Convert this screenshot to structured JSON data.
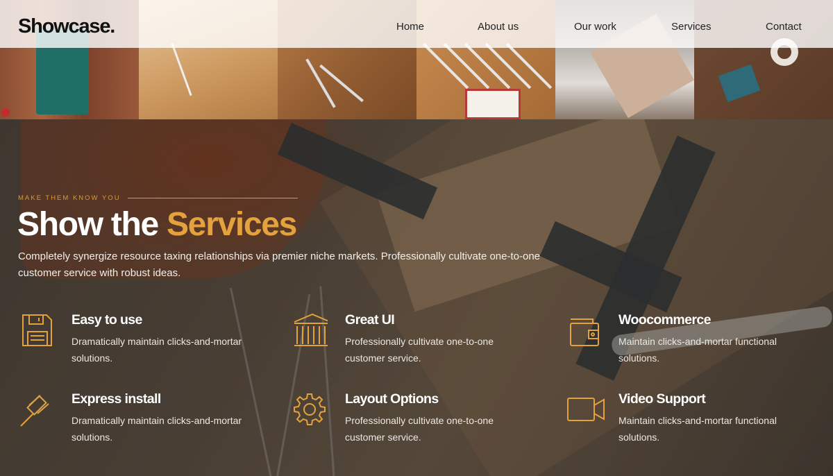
{
  "logo": "Showcase.",
  "nav": {
    "items": [
      "Home",
      "About us",
      "Our work",
      "Services",
      "Contact"
    ]
  },
  "hero": {
    "eyebrow": "MAKE THEM KNOW YOU",
    "title_plain": "Show the ",
    "title_accent": "Services",
    "description": "Completely synergize resource taxing relationships via premier niche markets. Professionally cultivate one-to-one customer service with robust ideas."
  },
  "features": [
    {
      "icon": "floppy-disk-icon",
      "title": "Easy to use",
      "description": "Dramatically maintain clicks-and-mortar solutions."
    },
    {
      "icon": "bank-columns-icon",
      "title": "Great UI",
      "description": "Professionally cultivate one-to-one customer service."
    },
    {
      "icon": "wallet-icon",
      "title": "Woocommerce",
      "description": "Maintain clicks-and-mortar functional solutions."
    },
    {
      "icon": "gavel-icon",
      "title": "Express install",
      "description": "Dramatically maintain clicks-and-mortar solutions."
    },
    {
      "icon": "gear-icon",
      "title": "Layout Options",
      "description": "Professionally cultivate one-to-one customer service."
    },
    {
      "icon": "video-camera-icon",
      "title": "Video Support",
      "description": "Maintain clicks-and-mortar functional solutions."
    }
  ],
  "colors": {
    "accent": "#e3a23e",
    "eyebrow": "#d8993a",
    "header_bg": "#ffffff",
    "text_light": "#ffffff"
  }
}
